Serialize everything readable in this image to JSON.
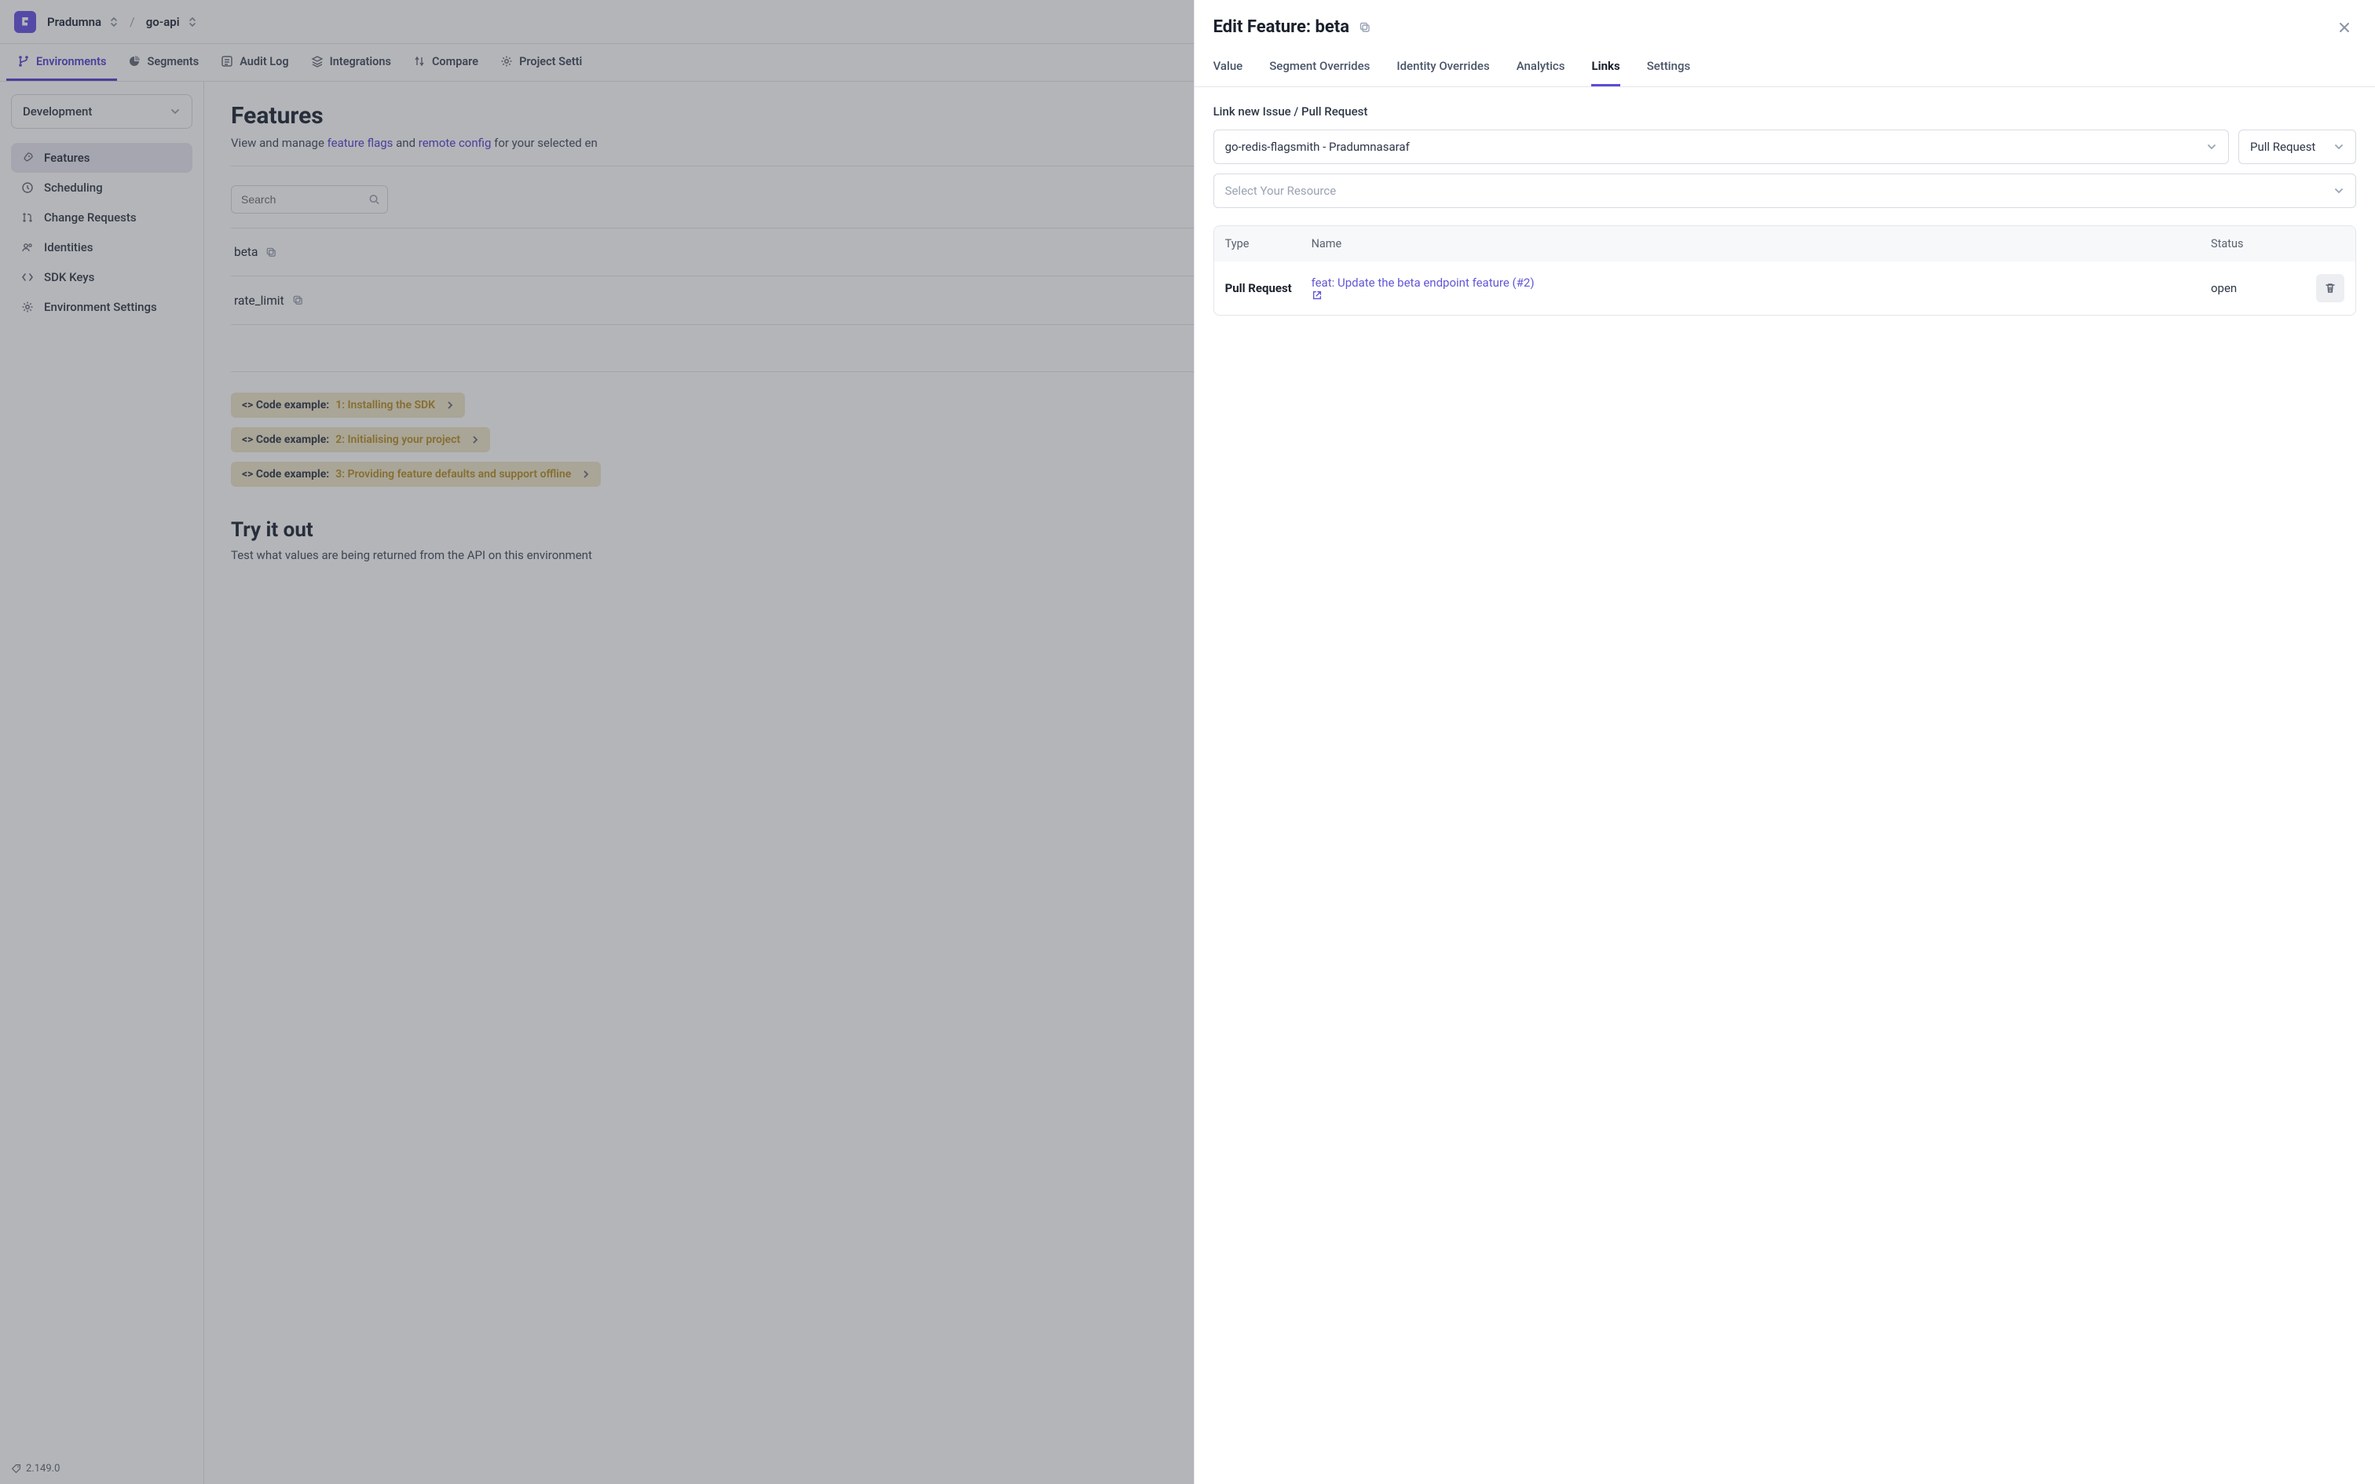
{
  "breadcrumb": {
    "org": "Pradumna",
    "project": "go-api"
  },
  "topTabs": [
    {
      "label": "Environments"
    },
    {
      "label": "Segments"
    },
    {
      "label": "Audit Log"
    },
    {
      "label": "Integrations"
    },
    {
      "label": "Compare"
    },
    {
      "label": "Project Setti"
    }
  ],
  "sidebar": {
    "env": "Development",
    "items": [
      {
        "label": "Features"
      },
      {
        "label": "Scheduling"
      },
      {
        "label": "Change Requests"
      },
      {
        "label": "Identities"
      },
      {
        "label": "SDK Keys"
      },
      {
        "label": "Environment Settings"
      }
    ]
  },
  "version": "2.149.0",
  "page": {
    "title": "Features",
    "subtitle_prefix": "View and manage ",
    "link_flags": "feature flags",
    "and": " and ",
    "link_remote": "remote config",
    "subtitle_suffix": " for your selected en",
    "search_placeholder": "Search"
  },
  "features": [
    {
      "name": "beta"
    },
    {
      "name": "rate_limit"
    }
  ],
  "codeExamples": [
    {
      "prefix": "<> Code example:",
      "link": "1: Installing the SDK"
    },
    {
      "prefix": "<> Code example:",
      "link": "2: Initialising your project"
    },
    {
      "prefix": "<> Code example:",
      "link": "3: Providing feature defaults and support offline"
    }
  ],
  "try": {
    "heading": "Try it out",
    "sub": "Test what values are being returned from the API on this environment"
  },
  "drawer": {
    "title": "Edit Feature: beta",
    "tabs": [
      {
        "label": "Value"
      },
      {
        "label": "Segment Overrides"
      },
      {
        "label": "Identity Overrides"
      },
      {
        "label": "Analytics"
      },
      {
        "label": "Links"
      },
      {
        "label": "Settings"
      }
    ],
    "section_label": "Link new Issue / Pull Request",
    "repo_value": "go-redis-flagsmith - Pradumnasaraf",
    "type_value": "Pull Request",
    "resource_placeholder": "Select Your Resource",
    "table": {
      "head": {
        "type": "Type",
        "name": "Name",
        "status": "Status"
      },
      "rows": [
        {
          "type": "Pull Request",
          "name": "feat: Update the beta endpoint feature (#2)",
          "status": "open"
        }
      ]
    }
  }
}
